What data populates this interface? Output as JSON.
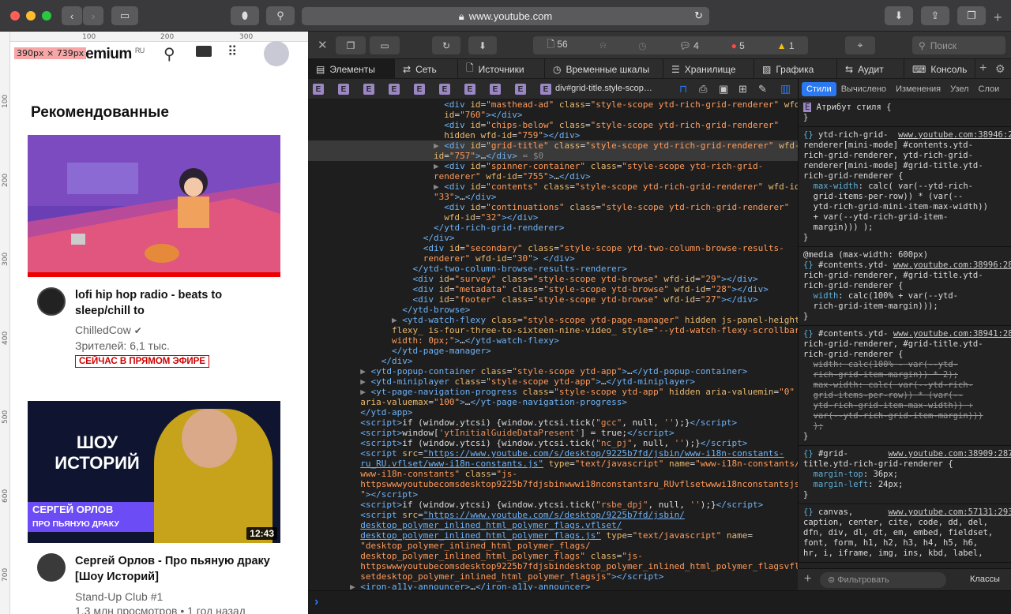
{
  "browser": {
    "url": "www.youtube.com",
    "colors": {
      "close": "#ff5f57",
      "min": "#febc2e",
      "max": "#28c840"
    }
  },
  "page": {
    "size_badge": "390px × 739px",
    "ruler_h": [
      "100",
      "200",
      "300"
    ],
    "ruler_v": [
      "100",
      "200",
      "300",
      "400",
      "500",
      "600",
      "700"
    ],
    "logo_text": "Premium",
    "logo_region": "RU",
    "section_title": "Рекомендованные",
    "videos": [
      {
        "title": "lofi hip hop radio - beats to sleep/chill to",
        "channel": "ChilledCow",
        "meta": "Зрителей: 6,1 тыс.",
        "badge": "СЕЙЧАС В ПРЯМОМ ЭФИРЕ"
      },
      {
        "title": "Сергей Орлов - Про пьяную драку [Шоу Историй]",
        "channel": "Stand-Up Club #1",
        "meta": "1,3 млн просмотров • 1 год назад",
        "duration": "12:43",
        "thumb_name": "СЕРГЕЙ ОРЛОВ",
        "thumb_sub": "ПРО ПЬЯНУЮ ДРАКУ",
        "thumb_show": "ШОУ ИСТОРИЙ"
      }
    ]
  },
  "devtools": {
    "toolbar": {
      "resources": "56",
      "logs": "4",
      "errors": "5",
      "warnings": "1",
      "search_placeholder": "Поиск"
    },
    "tabs": [
      "Элементы",
      "Сеть",
      "Источники",
      "Временные шкалы",
      "Хранилище",
      "Графика",
      "Аудит",
      "Консоль"
    ],
    "breadcrumb_last": "div#grid-title.style-scop…",
    "side_tabs": [
      "Стили",
      "Вычислено",
      "Изменения",
      "Узел",
      "Слои"
    ],
    "filter_placeholder": "Фильтровать",
    "classes_label": "Классы",
    "console_prompt": "›"
  }
}
